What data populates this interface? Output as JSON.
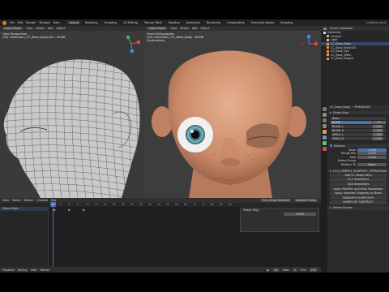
{
  "app": {
    "file_title": "Untitled.blend",
    "menu": [
      "File",
      "Edit",
      "Render",
      "Window",
      "Help"
    ],
    "workspaces": [
      "Layout",
      "Modeling",
      "Sculpting",
      "UV Editing",
      "Texture Paint",
      "Shading",
      "Animation",
      "Rendering",
      "Compositing",
      "Geometry Nodes",
      "Scripting"
    ],
    "active_workspace": "Layout"
  },
  "viewport_left": {
    "mode": "Object Mode",
    "menus": [
      "View",
      "Select",
      "Add",
      "Object"
    ],
    "overlay_line1": "User Perspective",
    "overlay_line2": "(35) Collection | CC_Base_Body.001 : BLINK"
  },
  "viewport_right": {
    "mode": "Object Mode",
    "menus": [
      "View",
      "Select",
      "Add",
      "Object"
    ],
    "overlay_line1": "Front Orthographic",
    "overlay_line2": "(35) Collection | CC_Base_Body : BLINK",
    "overlay_line3": "Centimeters"
  },
  "outliner": {
    "header": "Scene Collection",
    "items": [
      "Collection",
      "Camera",
      "Light",
      "CC_Base_Body",
      "CC_Base_Body.001",
      "CC_Base_Eye",
      "CC_Base_Teeth",
      "CC_Base_Tongue"
    ]
  },
  "properties": {
    "object_name": "CC_Base_Body",
    "data_name": "PRIMAUX03",
    "section_shape_keys": "Shape Keys",
    "shape_keys": [
      {
        "name": "Basis",
        "value": ""
      },
      {
        "name": "BLINK",
        "value": "1.000"
      },
      {
        "name": "BLINK_L",
        "value": "1.000"
      },
      {
        "name": "BLINK_R",
        "value": "1.000"
      },
      {
        "name": "SMILE_L",
        "value": "1.000"
      },
      {
        "name": "SMILE_R",
        "value": "1.000"
      }
    ],
    "section_relative": "Relative",
    "fields": [
      {
        "label": "Value",
        "value": "1.000"
      },
      {
        "label": "Range Min",
        "value": "0.000"
      },
      {
        "label": "Max",
        "value": "1.000"
      },
      {
        "label": "Vertex Group",
        "value": ""
      },
      {
        "label": "Relative To",
        "value": "Basis"
      }
    ],
    "panel_title": "CC3_COMPILE_SHAPEKEY_OPERATIONS",
    "operator_buttons": [
      "Add CC Shape Keys",
      "CC3 Shapekeys",
      "Split Shapekeys",
      "Apply Modifier and Keep Shapekeys",
      "Apply Selected Shapekey as Basis",
      "TRANSFER SHAPE KEYS",
      "SHAPE KEY SUBTRACT"
    ],
    "footer": "Vertex Groups"
  },
  "timeline": {
    "menus": [
      "View",
      "Select",
      "Marker",
      "Channel",
      "Key"
    ],
    "filter": "Only Show Selected",
    "tab": "Nearest Frame",
    "ticks": [
      "-10",
      "-5",
      "0",
      "5",
      "10",
      "15",
      "20",
      "25",
      "30",
      "35",
      "40",
      "45",
      "50",
      "55",
      "60",
      "65",
      "70",
      "75",
      "80",
      "85",
      "90"
    ],
    "channel_label": "Shape Keys",
    "channel_f_value": "0.000",
    "bottom_menus": [
      "Playback",
      "Keying",
      "View",
      "Marker"
    ],
    "frame_current": "35",
    "start_label": "Start",
    "start_value": "1",
    "end_label": "End",
    "end_value": "250"
  },
  "colors": {
    "accent": "#4772b3",
    "bg": "#2b2b2b",
    "timeline_bg": "#1f1f1f",
    "frame_indicator": "#4772b3"
  }
}
